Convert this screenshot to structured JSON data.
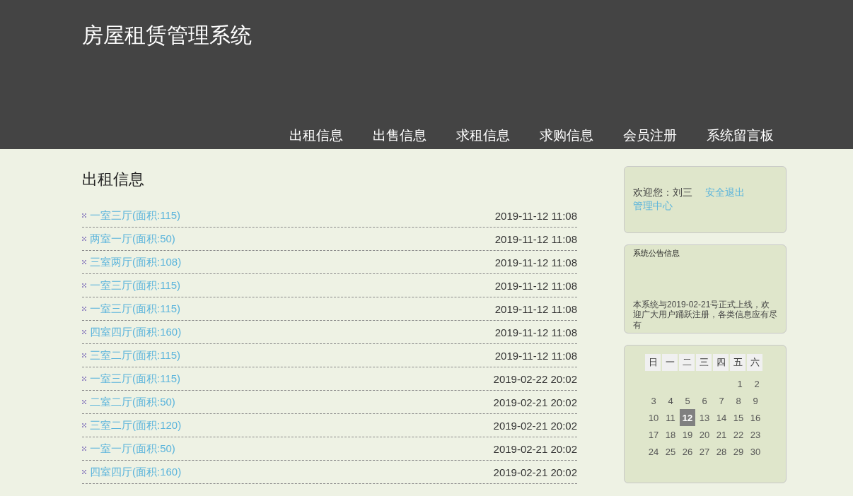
{
  "header": {
    "title": "房屋租赁管理系统"
  },
  "nav": [
    {
      "label": "出租信息"
    },
    {
      "label": "出售信息"
    },
    {
      "label": "求租信息"
    },
    {
      "label": "求购信息"
    },
    {
      "label": "会员注册"
    },
    {
      "label": "系统留言板"
    }
  ],
  "listing": {
    "heading": "出租信息",
    "items": [
      {
        "title": "一室三厅(面积:115)",
        "time": "2019-11-12 11:08"
      },
      {
        "title": "两室一厅(面积:50)",
        "time": "2019-11-12 11:08"
      },
      {
        "title": "三室两厅(面积:108)",
        "time": "2019-11-12 11:08"
      },
      {
        "title": "一室三厅(面积:115)",
        "time": "2019-11-12 11:08"
      },
      {
        "title": "一室三厅(面积:115)",
        "time": "2019-11-12 11:08"
      },
      {
        "title": "四室四厅(面积:160)",
        "time": "2019-11-12 11:08"
      },
      {
        "title": "三室二厅(面积:115)",
        "time": "2019-11-12 11:08"
      },
      {
        "title": "一室三厅(面积:115)",
        "time": "2019-02-22 20:02"
      },
      {
        "title": "二室二厅(面积:50)",
        "time": "2019-02-21 20:02"
      },
      {
        "title": "三室二厅(面积:120)",
        "time": "2019-02-21 20:02"
      },
      {
        "title": "一室一厅(面积:50)",
        "time": "2019-02-21 20:02"
      },
      {
        "title": "四室四厅(面积:160)",
        "time": "2019-02-21 20:02"
      }
    ]
  },
  "user_panel": {
    "welcome": "欢迎您：刘三",
    "logout": "安全退出",
    "admin": "管理中心"
  },
  "notice": {
    "title": "系统公告信息",
    "text": "本系统与2019-02-21号正式上线，欢迎广大用户踊跃注册，各类信息应有尽有"
  },
  "calendar": {
    "weekdays": [
      "日",
      "一",
      "二",
      "三",
      "四",
      "五",
      "六"
    ],
    "weeks": [
      {
        "days": [
          {
            "label": "1",
            "selected": false
          },
          {
            "label": "2",
            "selected": false
          }
        ]
      },
      {
        "days": [
          {
            "label": "3",
            "selected": false
          },
          {
            "label": "4",
            "selected": false
          },
          {
            "label": "5",
            "selected": false
          },
          {
            "label": "6",
            "selected": false
          },
          {
            "label": "7",
            "selected": false
          },
          {
            "label": "8",
            "selected": false
          },
          {
            "label": "9",
            "selected": false
          }
        ]
      },
      {
        "days": [
          {
            "label": "10",
            "selected": false
          },
          {
            "label": "11",
            "selected": false
          },
          {
            "label": "12",
            "selected": true
          },
          {
            "label": "13",
            "selected": false
          },
          {
            "label": "14",
            "selected": false
          },
          {
            "label": "15",
            "selected": false
          },
          {
            "label": "16",
            "selected": false
          }
        ]
      },
      {
        "days": [
          {
            "label": "17",
            "selected": false
          },
          {
            "label": "18",
            "selected": false
          },
          {
            "label": "19",
            "selected": false
          },
          {
            "label": "20",
            "selected": false
          },
          {
            "label": "21",
            "selected": false
          },
          {
            "label": "22",
            "selected": false
          },
          {
            "label": "23",
            "selected": false
          }
        ]
      },
      {
        "days": [
          {
            "label": "24",
            "selected": false
          },
          {
            "label": "25",
            "selected": false
          },
          {
            "label": "26",
            "selected": false
          },
          {
            "label": "27",
            "selected": false
          },
          {
            "label": "28",
            "selected": false
          },
          {
            "label": "29",
            "selected": false
          },
          {
            "label": "30",
            "selected": false
          }
        ]
      }
    ]
  }
}
